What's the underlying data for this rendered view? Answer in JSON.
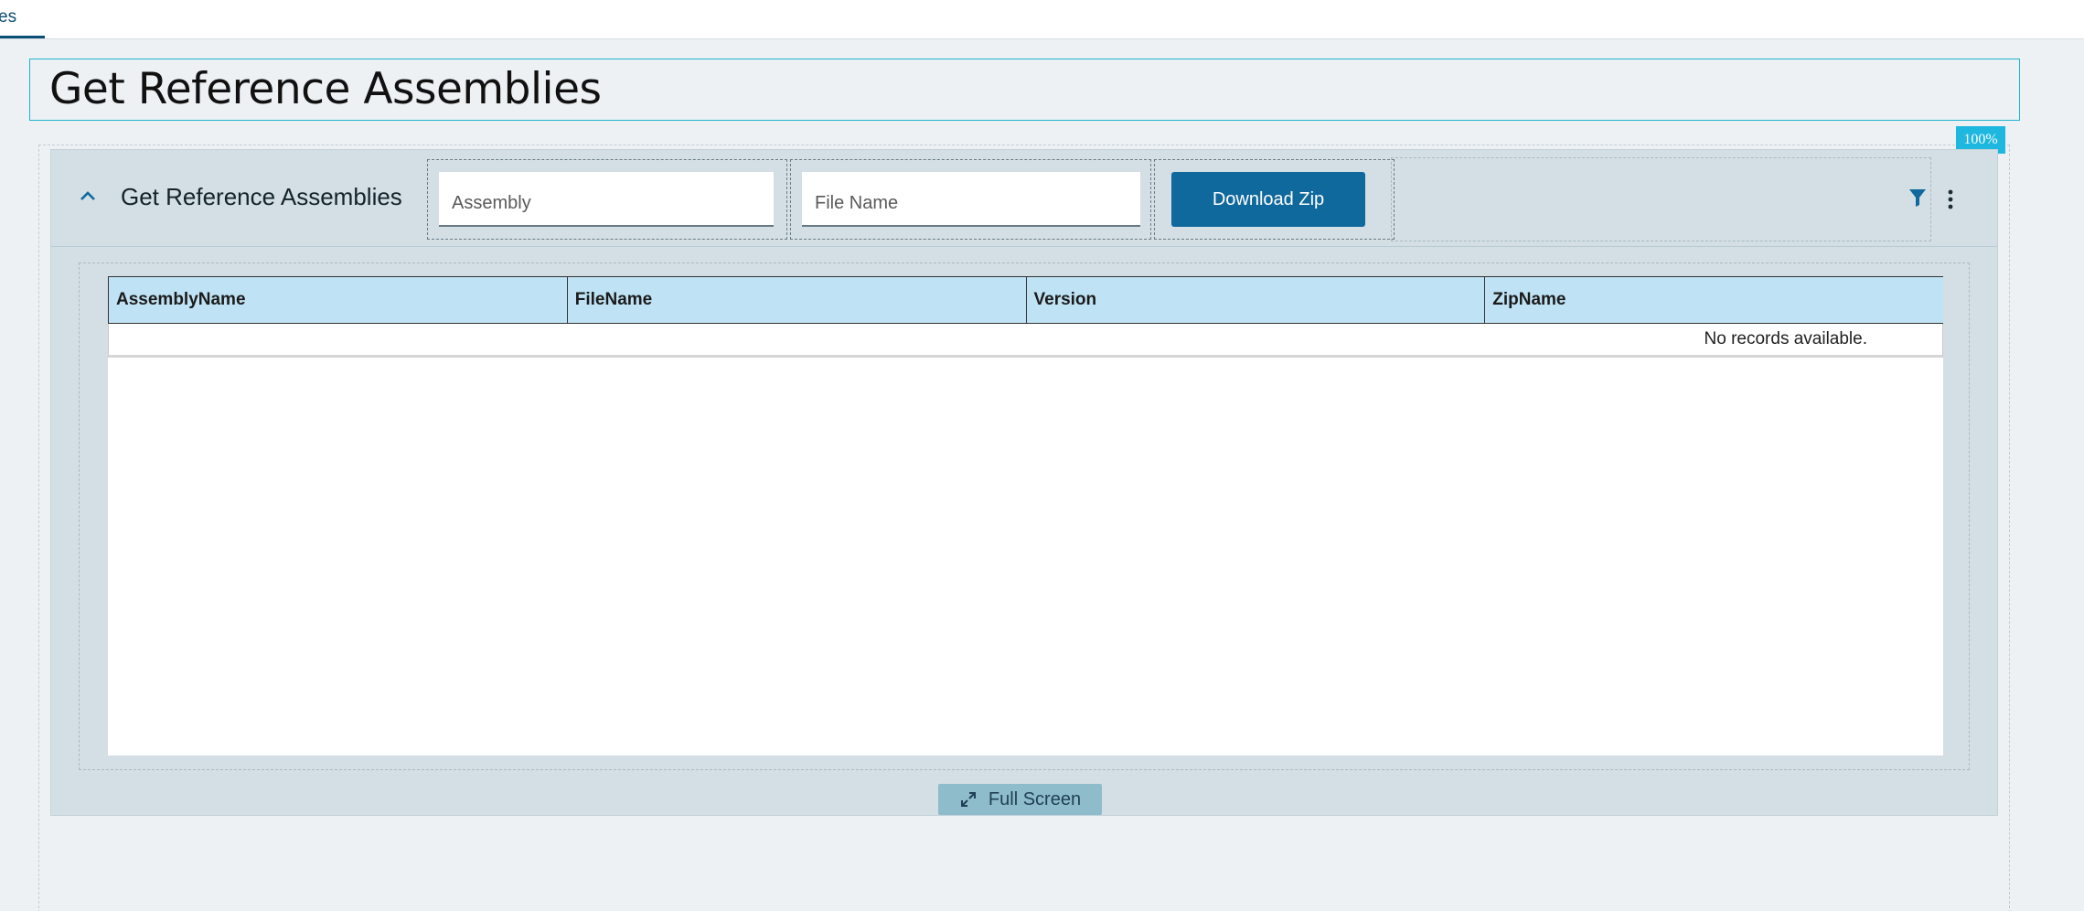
{
  "top_tab": {
    "label": "es"
  },
  "page": {
    "title": "Get Reference Assemblies"
  },
  "zoom": {
    "label": "100%"
  },
  "panel": {
    "title": "Get Reference Assemblies",
    "assembly_placeholder": "Assembly",
    "filename_placeholder": "File Name",
    "download_label": "Download Zip",
    "fullscreen_label": "Full Screen"
  },
  "grid": {
    "columns": [
      "AssemblyName",
      "FileName",
      "Version",
      "ZipName"
    ],
    "empty_message": "No records available."
  },
  "icons": {
    "collapse": "chevron-up-icon",
    "filter": "filter-icon",
    "more": "kebab-icon",
    "fullscreen": "expand-icon"
  },
  "colors": {
    "accent": "#10699c",
    "header_bg": "#bfe3f5",
    "zoom_badge": "#1eb7e0"
  }
}
